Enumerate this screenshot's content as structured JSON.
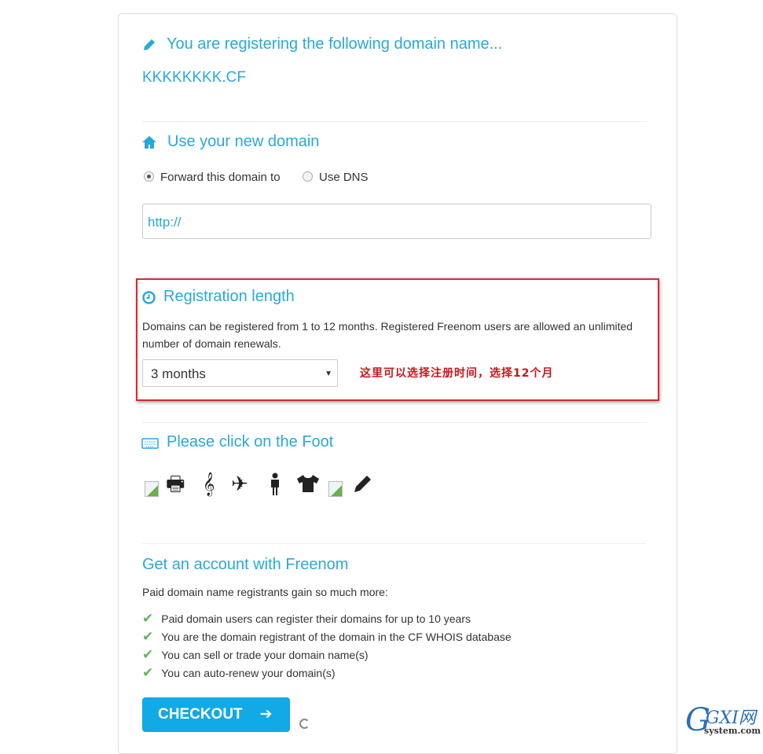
{
  "domain_section": {
    "title": "You are registering the following domain name...",
    "domain": "KKKKKKKK.CF",
    "icon": "pencil-icon"
  },
  "use_section": {
    "title": "Use your new domain",
    "icon": "home-icon",
    "option_forward": "Forward this domain to",
    "option_dns": "Use DNS",
    "selected": "forward",
    "url_value": "http://"
  },
  "registration": {
    "title": "Registration length",
    "icon": "clock-icon",
    "description": "Domains can be registered from 1 to 12 months. Registered Freenom users are allowed an unlimited number of domain renewals.",
    "selected": "3 months",
    "annotation": "这里可以选择注册时间，选择12个月",
    "annotation_color": "#c8161d"
  },
  "captcha": {
    "title": "Please click on the Foot",
    "icon": "keyboard-icon",
    "icons": [
      "broken-image",
      "print",
      "treble-clef",
      "plane",
      "male",
      "t-shirt",
      "broken-image",
      "pencil"
    ]
  },
  "account": {
    "title": "Get an account with Freenom",
    "intro": "Paid domain name registrants gain so much more:",
    "benefits": [
      "Paid domain users can register their domains for up to 10 years",
      "You are the domain registrant of the domain in the CF WHOIS database",
      "You can sell or trade your domain name(s)",
      "You can auto-renew your domain(s)"
    ]
  },
  "checkout": {
    "label": "CHECKOUT",
    "arrow": "➔"
  },
  "watermark": {
    "text": "GXI网",
    "sub": "system.com"
  },
  "colors": {
    "accent": "#29a9d8",
    "button": "#11a9e6",
    "check": "#5cb85c",
    "highlight": "#d9282f"
  }
}
